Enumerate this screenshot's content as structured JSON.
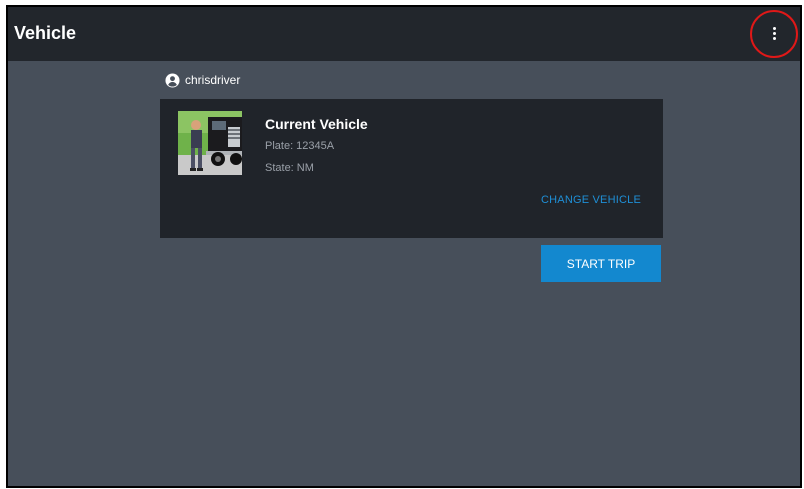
{
  "appbar": {
    "title": "Vehicle",
    "overflow_icon": "more-vert-icon"
  },
  "user": {
    "icon": "account-circle-icon",
    "name": "chrisdriver"
  },
  "vehicle_card": {
    "title": "Current Vehicle",
    "plate": "Plate: 12345A",
    "state": "State: NM",
    "change_label": "CHANGE VEHICLE",
    "image": "truck-photo"
  },
  "actions": {
    "start_trip_label": "START TRIP"
  },
  "colors": {
    "background": "#474f5a",
    "appbar": "#22262c",
    "card": "#20242a",
    "accent": "#1388cf",
    "link": "#1f8fd6",
    "highlight": "#e01818"
  }
}
